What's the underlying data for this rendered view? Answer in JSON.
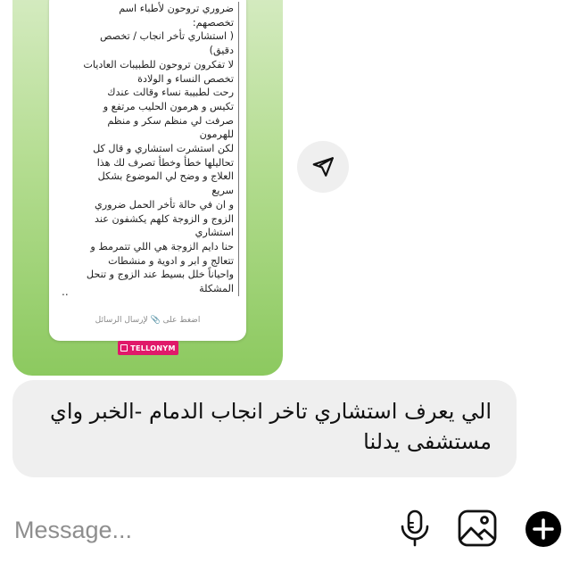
{
  "shared_post": {
    "note_lines": [
      "ضروري تروحون لأطباء اسم",
      "تخصصهم:",
      "( استشاري تأخر انجاب / تخصص",
      "دقيق)",
      "لا تفكرون تروحون للطبيبات العاديات",
      "تخصص النساء و الولادة",
      "رحت لطبيبة نساء وقالت عندك",
      "تكيس و هرمون الحليب مرتفع و",
      "صرفت لي منظم سكر و منظم",
      "للهرمون",
      "لكن استشرت استشاري و قال كل",
      "تحاليلها خطأ وخطأ تصرف لك هذا",
      "العلاج و وضح لي الموضوع بشكل",
      "سريع",
      "و ان في حالة تأخر الحمل ضروري",
      "الزوج و الزوجة كلهم يكشفون عند",
      "استشاري",
      "حنا دايم الزوجة هي اللي تتمرمط و",
      "تتعالج و ابر و ادوية و منشطات",
      "واحياناً خلل بسيط عند الزوج و تنحل",
      "المشكلة"
    ],
    "trailing_dots": "..",
    "hint_text": "اضغط على 📎 لإرسال الرسائل",
    "brand_label": "TELLONYM",
    "colors": {
      "brand": "#e0196a",
      "card_gradient_end": "#8cc95f"
    }
  },
  "share_action": {
    "icon": "send-icon"
  },
  "message": {
    "text": "الي يعرف استشاري تاخر انجاب الدمام -الخبر واي مستشفى يدلنا"
  },
  "composer": {
    "placeholder": "Message...",
    "icons": [
      "microphone-icon",
      "gallery-icon",
      "add-icon"
    ]
  }
}
